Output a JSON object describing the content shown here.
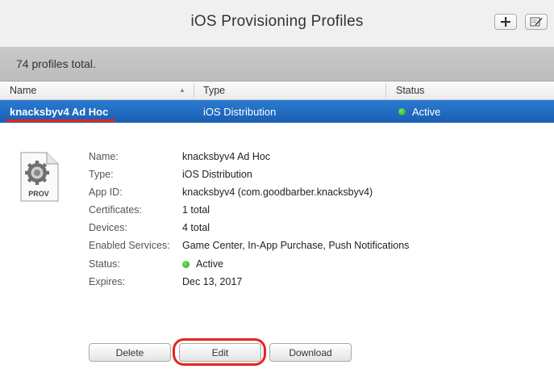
{
  "window": {
    "title": "iOS Provisioning Profiles"
  },
  "toolbar": {
    "add_icon": "plus-icon",
    "edit_icon": "note-edit-icon"
  },
  "summary": {
    "text": "74 profiles total."
  },
  "columns": {
    "name": "Name",
    "type": "Type",
    "status": "Status"
  },
  "selected_row": {
    "name": "knacksbyv4 Ad Hoc",
    "type": "iOS Distribution",
    "status": "Active"
  },
  "details": {
    "icon_label": "PROV",
    "fields": [
      {
        "label": "Name:",
        "value": "knacksbyv4 Ad Hoc"
      },
      {
        "label": "Type:",
        "value": "iOS Distribution"
      },
      {
        "label": "App ID:",
        "value": "knacksbyv4 (com.goodbarber.knacksbyv4)"
      },
      {
        "label": "Certificates:",
        "value": "1 total"
      },
      {
        "label": "Devices:",
        "value": "4 total"
      },
      {
        "label": "Enabled Services:",
        "value": "Game Center, In-App Purchase, Push Notifications"
      },
      {
        "label": "Status:",
        "value": "Active"
      },
      {
        "label": "Expires:",
        "value": "Dec 13, 2017"
      }
    ]
  },
  "actions": {
    "delete": "Delete",
    "edit": "Edit",
    "download": "Download"
  },
  "colors": {
    "selection": "#1a5fb2",
    "highlight": "#e8231f",
    "active_dot": "#1fa51a"
  }
}
